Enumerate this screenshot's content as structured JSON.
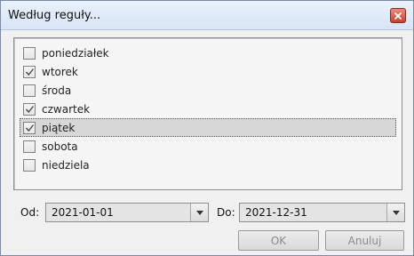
{
  "window": {
    "title": "Według reguły...",
    "close_icon": "close-icon"
  },
  "days": [
    {
      "label": "poniedziałek",
      "checked": false
    },
    {
      "label": "wtorek",
      "checked": true
    },
    {
      "label": "środa",
      "checked": false
    },
    {
      "label": "czwartek",
      "checked": true
    },
    {
      "label": "piątek",
      "checked": true,
      "selected": true
    },
    {
      "label": "sobota",
      "checked": false
    },
    {
      "label": "niedziela",
      "checked": false
    }
  ],
  "range": {
    "from_label": "Od:",
    "from_value": "2021-01-01",
    "to_label": "Do:",
    "to_value": "2021-12-31"
  },
  "buttons": {
    "ok_label": "OK",
    "cancel_label": "Anuluj"
  },
  "colors": {
    "titlebar": "#d8e5f5",
    "close_button": "#c9412d",
    "selection": "#d7d7d7"
  }
}
